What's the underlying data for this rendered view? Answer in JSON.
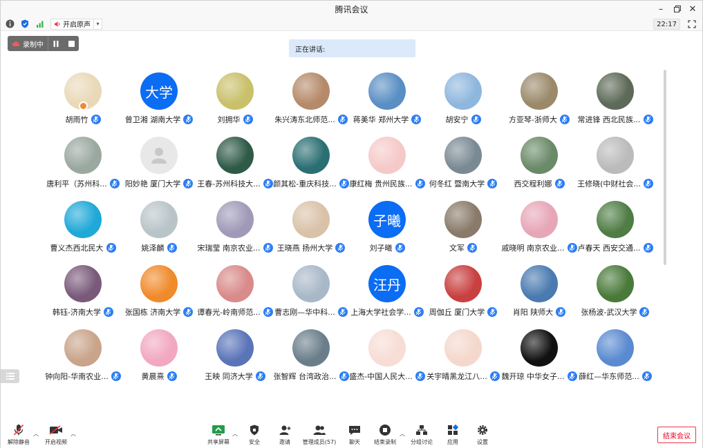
{
  "window": {
    "title": "腾讯会议"
  },
  "toolbar": {
    "audio_label": "开启原声",
    "clock": "22:17"
  },
  "recording": {
    "label": "录制中"
  },
  "speaking": {
    "label": "正在讲话:"
  },
  "participants": [
    {
      "name": "胡雨竹",
      "avatar": "photo",
      "color": "#e9d9b8"
    },
    {
      "name": "曾卫湘 湖南大学",
      "avatar": "text",
      "text": "大学"
    },
    {
      "name": "刘拥华",
      "avatar": "photo",
      "color": "#c9c06a"
    },
    {
      "name": "朱兴涛东北师范...",
      "avatar": "photo",
      "color": "#b58a6a"
    },
    {
      "name": "蒋美华 郑州大学",
      "avatar": "photo",
      "color": "#5a8fc4"
    },
    {
      "name": "胡安宁",
      "avatar": "photo",
      "color": "#8fb7de"
    },
    {
      "name": "方亚琴-浙师大",
      "avatar": "photo",
      "color": "#9a8a6a"
    },
    {
      "name": "常进锋 西北民族...",
      "avatar": "photo",
      "color": "#5d6a58"
    },
    {
      "name": "唐利平（苏州科...",
      "avatar": "photo",
      "color": "#9aa8a0"
    },
    {
      "name": "阳妙艳 厦门大学",
      "avatar": "default",
      "color": "#e8e8e8"
    },
    {
      "name": "王春-苏州科技大...",
      "avatar": "photo",
      "color": "#2f5a48"
    },
    {
      "name": "颜其松-重庆科技...",
      "avatar": "photo",
      "color": "#2b6f73"
    },
    {
      "name": "康红梅 贵州民族...",
      "avatar": "photo",
      "color": "#f6c9c9"
    },
    {
      "name": "何冬红 暨南大学",
      "avatar": "photo",
      "color": "#7a8a94"
    },
    {
      "name": "西交程利娜",
      "avatar": "photo",
      "color": "#6a8a68"
    },
    {
      "name": "王修晓(中财社会...",
      "avatar": "photo",
      "color": "#bbbbbb"
    },
    {
      "name": "曹义杰西北民大",
      "avatar": "photo",
      "color": "#1fa8d8"
    },
    {
      "name": "姚泽麟",
      "avatar": "photo",
      "color": "#b9c4c8"
    },
    {
      "name": "宋瑞莹 南京农业...",
      "avatar": "photo",
      "color": "#a09ab8"
    },
    {
      "name": "王晓燕 扬州大学",
      "avatar": "photo",
      "color": "#d9c2a8"
    },
    {
      "name": "刘子曦",
      "avatar": "text",
      "text": "子曦"
    },
    {
      "name": "文军",
      "avatar": "photo",
      "color": "#8a7a6a"
    },
    {
      "name": "戚晓明 南京农业...",
      "avatar": "photo",
      "color": "#e7a6b8"
    },
    {
      "name": "卢春天 西安交通...",
      "avatar": "photo",
      "color": "#4f7d45"
    },
    {
      "name": "韩钰-济南大学",
      "avatar": "photo",
      "color": "#7a5a7a"
    },
    {
      "name": "张国栋 济南大学",
      "avatar": "photo",
      "color": "#f08a2a"
    },
    {
      "name": "谭春光-岭南师范...",
      "avatar": "photo",
      "color": "#d98a8a"
    },
    {
      "name": "曹志刚—华中科...",
      "avatar": "photo",
      "color": "#a9b8c8"
    },
    {
      "name": "上海大学社会学...",
      "avatar": "text",
      "text": "汪丹"
    },
    {
      "name": "周伽丘 厦门大学",
      "avatar": "photo",
      "color": "#c94040"
    },
    {
      "name": "肖阳 陕师大",
      "avatar": "photo",
      "color": "#4a7ab0"
    },
    {
      "name": "张杨波-武汉大学",
      "avatar": "photo",
      "color": "#4a7a3a"
    },
    {
      "name": "钟向阳-华南农业...",
      "avatar": "photo",
      "color": "#c9a48a"
    },
    {
      "name": "黄晨熹",
      "avatar": "photo",
      "color": "#f2a8c0"
    },
    {
      "name": "王映 同济大学",
      "avatar": "photo",
      "color": "#5a74b8"
    },
    {
      "name": "张智辉 台湾政治...",
      "avatar": "photo",
      "color": "#6a7e8a"
    },
    {
      "name": "盛杰-中国人民大...",
      "avatar": "photo",
      "color": "#f7ddd5"
    },
    {
      "name": "关宇晴黑龙江八...",
      "avatar": "photo",
      "color": "#f4d8cc"
    },
    {
      "name": "魏开琼 中华女子...",
      "avatar": "photo",
      "color": "#111111"
    },
    {
      "name": "薛红—华东师范...",
      "avatar": "photo",
      "color": "#5a8ad0"
    }
  ],
  "bottom": {
    "unmute": "解除静音",
    "video": "开启视频",
    "share": "共享屏幕",
    "security": "安全",
    "invite": "邀请",
    "members": "管理成员(57)",
    "chat": "聊天",
    "stop_record": "结束录制",
    "breakout": "分组讨论",
    "apps": "应用",
    "settings": "设置",
    "end": "结束会议"
  }
}
